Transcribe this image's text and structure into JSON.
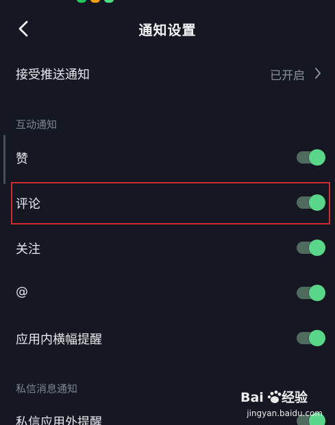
{
  "header": {
    "title": "通知设置",
    "back_icon": "chevron-left-icon"
  },
  "push_row": {
    "label": "接受推送通知",
    "status": "已开启",
    "chevron_icon": "chevron-right-icon"
  },
  "sections": [
    {
      "title": "互动通知",
      "items": [
        {
          "label": "赞",
          "enabled": true
        },
        {
          "label": "评论",
          "enabled": true,
          "highlighted": true
        },
        {
          "label": "关注",
          "enabled": true
        },
        {
          "label": "@",
          "enabled": true
        },
        {
          "label": "应用内横幅提醒",
          "enabled": true
        }
      ]
    },
    {
      "title": "私信消息通知",
      "items": [
        {
          "label": "私信应用外提醒",
          "enabled": true
        }
      ]
    }
  ],
  "colors": {
    "background": "#151722",
    "toggle_on": "#5ad68a",
    "highlight": "#d12a2f"
  },
  "watermark": {
    "logo_text": "Baidu经验",
    "site": "jingyan.baidu.com"
  }
}
